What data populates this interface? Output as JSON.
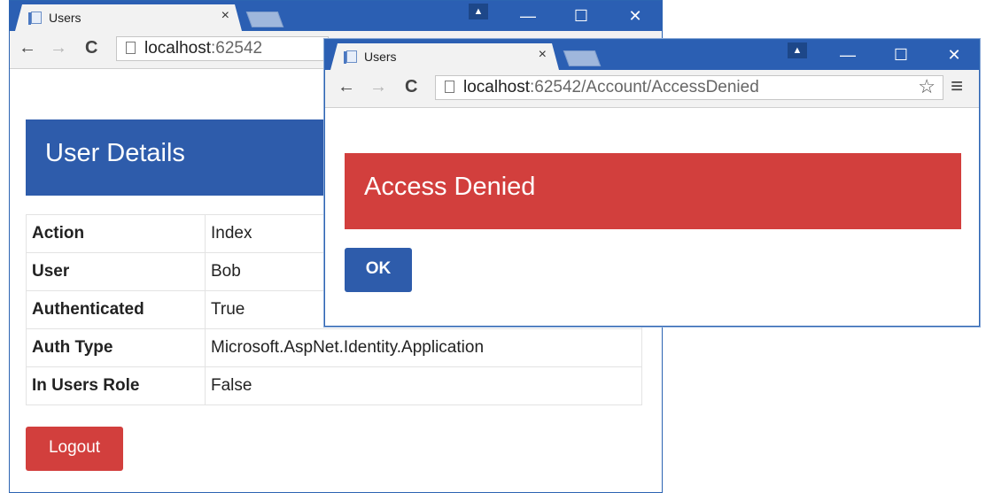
{
  "back_window": {
    "tab_title": "Users",
    "tab_close": "×",
    "controls": {
      "user": "▲",
      "minimize": "—",
      "maximize": "☐",
      "close": "✕"
    },
    "nav": {
      "back": "←",
      "forward": "→",
      "reload": "C"
    },
    "address": {
      "host": "localhost",
      "path": ":62542"
    },
    "page": {
      "title": "User Details",
      "rows": [
        {
          "key": "Action",
          "value": "Index"
        },
        {
          "key": "User",
          "value": "Bob"
        },
        {
          "key": "Authenticated",
          "value": "True"
        },
        {
          "key": "Auth Type",
          "value": "Microsoft.AspNet.Identity.Application"
        },
        {
          "key": "In Users Role",
          "value": "False"
        }
      ],
      "logout_label": "Logout"
    }
  },
  "front_window": {
    "tab_title": "Users",
    "tab_close": "×",
    "controls": {
      "user": "▲",
      "minimize": "—",
      "maximize": "☐",
      "close": "✕"
    },
    "nav": {
      "back": "←",
      "forward": "→",
      "reload": "C"
    },
    "address": {
      "host": "localhost",
      "path": ":62542/Account/AccessDenied"
    },
    "toolbar_icons": {
      "star": "☆",
      "menu": "≡"
    },
    "page": {
      "title": "Access Denied",
      "ok_label": "OK"
    }
  },
  "colors": {
    "titlebar": "#2b5fb3",
    "primary": "#2e5cab",
    "danger": "#d23f3d"
  }
}
